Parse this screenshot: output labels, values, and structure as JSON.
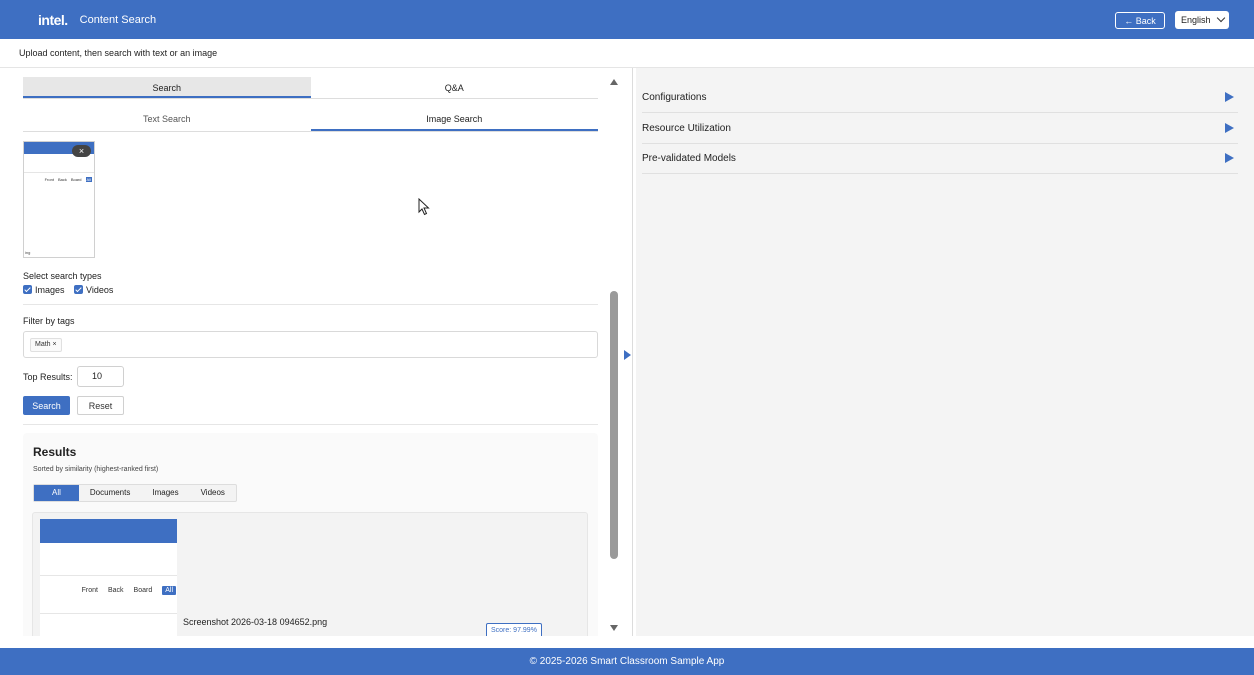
{
  "header": {
    "logo": "intel.",
    "title": "Content Search",
    "back_label": "← Back",
    "language": "English"
  },
  "subheader": {
    "instruction": "Upload content, then search with text or an image"
  },
  "search_panel": {
    "mode_tabs": [
      "Search",
      "Q&A"
    ],
    "search_tabs": [
      "Text Search",
      "Image Search"
    ],
    "thumbnail": {
      "remove_label": "×",
      "nav": [
        "Front",
        "Back",
        "Board",
        "All"
      ],
      "caption": "ing"
    },
    "search_types": {
      "label": "Select search types",
      "options": [
        {
          "label": "Images",
          "checked": true
        },
        {
          "label": "Videos",
          "checked": true
        }
      ]
    },
    "tags": {
      "label": "Filter by tags",
      "items": [
        {
          "label": "Math",
          "remove": "×"
        }
      ]
    },
    "top_results": {
      "label": "Top Results:",
      "value": "10"
    },
    "search_button": "Search",
    "reset_button": "Reset"
  },
  "results": {
    "title": "Results",
    "subtitle": "Sorted by similarity (highest-ranked first)",
    "filters": [
      "All",
      "Documents",
      "Images",
      "Videos"
    ],
    "items": [
      {
        "name": "Screenshot 2026-03-18 094652.png",
        "score": "Score: 97.99%",
        "thumb_nav": [
          "Front",
          "Back",
          "Board",
          "All"
        ]
      }
    ]
  },
  "right_panel": {
    "sections": [
      "Configurations",
      "Resource Utilization",
      "Pre-validated Models"
    ]
  },
  "footer": {
    "text": "© 2025-2026 Smart Classroom Sample App"
  },
  "colors": {
    "brand": "#3e6fc2",
    "panel_bg": "#f4f4f4"
  }
}
